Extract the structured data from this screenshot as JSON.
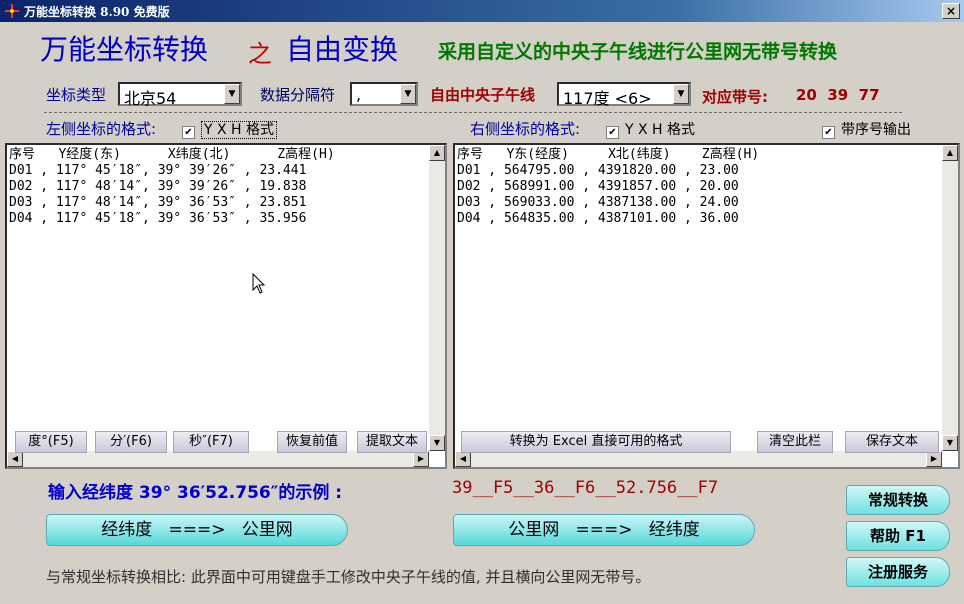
{
  "window": {
    "title": "万能坐标转换 8.90 免费版",
    "close_label": "×"
  },
  "header": {
    "title_part1": "万能坐标转换",
    "title_connector": "之",
    "title_part2": "自由变换",
    "slogan": "采用自定义的中央子午线进行公里网无带号转换"
  },
  "settings": {
    "coord_type_label": "坐标类型",
    "coord_type_value": "北京54",
    "separator_label": "数据分隔符",
    "separator_value": ",",
    "meridian_label": "自由中央子午线",
    "meridian_value": "117度 <6>",
    "zone_label": "对应带号:",
    "zone_values": "20  39  77"
  },
  "left": {
    "format_label": "左侧坐标的格式:",
    "format_option": "Y X H 格式",
    "format_checked": true,
    "text": "序号   Y经度(东)      X纬度(北)      Z高程(H)\nD01 , 117° 45′18″, 39° 39′26″ , 23.441\nD02 , 117° 48′14″, 39° 39′26″ , 19.838\nD03 , 117° 48′14″, 39° 36′53″ , 23.851\nD04 , 117° 45′18″, 39° 36′53″ , 35.956",
    "buttons": [
      "度°(F5)",
      "分′(F6)",
      "秒″(F7)",
      "恢复前值",
      "提取文本"
    ]
  },
  "right": {
    "format_label": "右侧坐标的格式:",
    "format_option": "Y X H 格式",
    "format_checked": true,
    "serial_option": "带序号输出",
    "serial_checked": true,
    "text": "序号   Y东(经度)     X北(纬度)    Z高程(H)\nD01 , 564795.00 , 4391820.00 , 23.00\nD02 , 568991.00 , 4391857.00 , 20.00\nD03 , 569033.00 , 4387138.00 , 24.00\nD04 , 564835.00 , 4387101.00 , 36.00",
    "buttons": [
      "转换为 Excel 直接可用的格式",
      "清空此栏",
      "保存文本"
    ]
  },
  "example": {
    "label": "输入经纬度 39° 36′52.756″的示例 :",
    "value": "39__F5__36__F6__52.756__F7"
  },
  "actions": {
    "to_grid": "经纬度   ===>   公里网",
    "to_latlon": "公里网   ===>   经纬度",
    "normal": "常规转换",
    "help": "帮助 F1",
    "register": "注册服务"
  },
  "footer": "与常规坐标转换相比: 此界面中可用键盘手工修改中央子午线的值, 并且横向公里网无带号。",
  "icons": {
    "app": "crosshair-app-icon",
    "cursor": "mouse-pointer-icon",
    "scroll_up": "up-arrow-icon",
    "scroll_down": "down-arrow-icon",
    "scroll_left": "left-arrow-icon",
    "scroll_right": "right-arrow-icon",
    "dropdown": "chevron-down-icon",
    "check": "checkmark-icon"
  },
  "colors": {
    "title_blue": "#0000c8",
    "accent_red": "#c80000",
    "slogan_green": "#007800",
    "button_teal": "#58d8d8"
  }
}
